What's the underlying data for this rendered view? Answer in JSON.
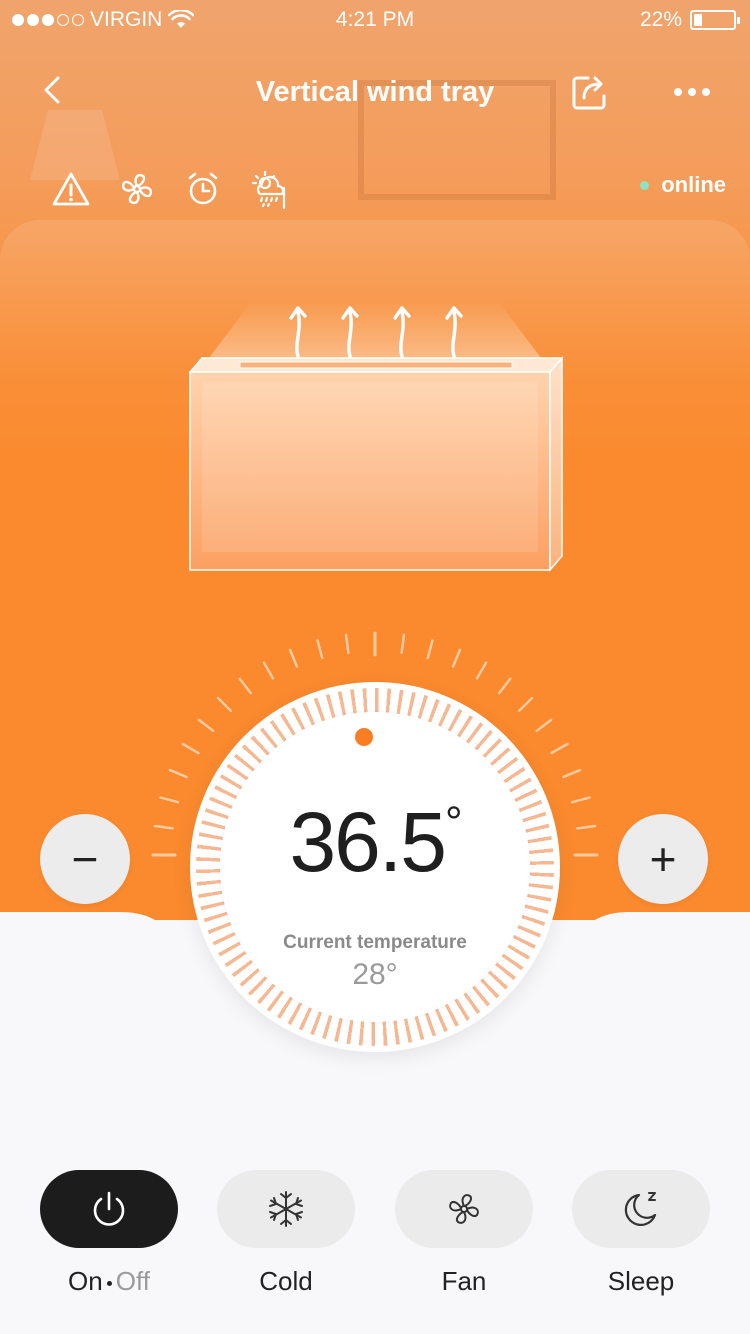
{
  "status_bar": {
    "carrier": "VIRGIN",
    "time": "4:21 PM",
    "battery_text": "22%",
    "battery_level": 0.22,
    "signal_bars": [
      true,
      true,
      true,
      false,
      false
    ]
  },
  "nav": {
    "title": "Vertical wind tray",
    "back_icon": "chevron-left-icon",
    "share_icon": "share-icon",
    "more_icon": "more-dots-icon"
  },
  "indicators": {
    "icons": [
      "warning-icon",
      "fan-icon",
      "alarm-clock-icon",
      "weather-icon"
    ],
    "connection": "online",
    "connection_color": "#8fe3c5"
  },
  "thermostat": {
    "set_temp": "36.5",
    "degree_symbol": "°",
    "current_label": "Current temperature",
    "current_value": "28°",
    "minus_label": "−",
    "plus_label": "+"
  },
  "modes": [
    {
      "label_on": "On",
      "label_off": "Off",
      "icon": "power-icon",
      "active": true
    },
    {
      "label": "Cold",
      "icon": "snowflake-icon",
      "active": false
    },
    {
      "label": "Fan",
      "icon": "fan-icon",
      "active": false
    },
    {
      "label": "Sleep",
      "icon": "moon-sleep-icon",
      "active": false
    }
  ],
  "colors": {
    "accent": "#fb8a2e",
    "dial_dot": "#fb7d23",
    "active_button": "#1c1c1c",
    "background": "#f8f8fa"
  }
}
